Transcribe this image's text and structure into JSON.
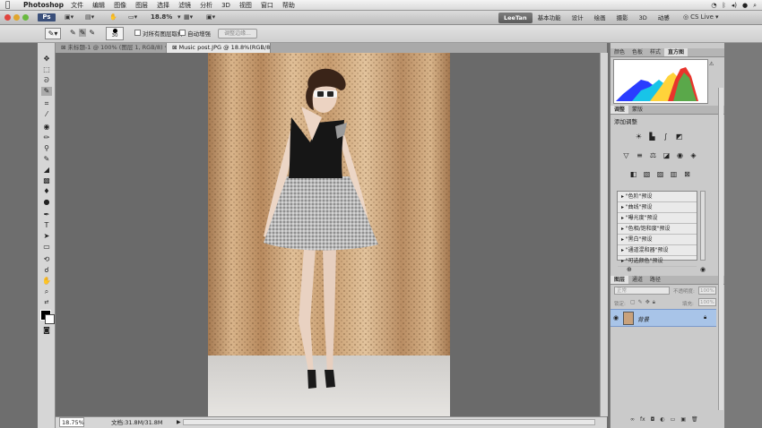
{
  "menubar": {
    "app_name": "Photoshop",
    "items": [
      "文件",
      "编辑",
      "图像",
      "图层",
      "选择",
      "滤镜",
      "分析",
      "3D",
      "视图",
      "窗口",
      "帮助"
    ],
    "right": "CS Live"
  },
  "appbar": {
    "zoom": "18.8%",
    "workspaces": [
      "LeeTan",
      "基本功能",
      "设计",
      "绘画",
      "摄影",
      "3D",
      "动感"
    ]
  },
  "options": {
    "brush_size": "30",
    "checkbox1": "对所有图层取样",
    "checkbox2": "自动增强",
    "refine_button": "调整边缘..."
  },
  "tabs": [
    {
      "label": "未标题-1 @ 100% (图层 1, RGB/8) *"
    },
    {
      "label": "Music post.JPG @ 18.8%(RGB/8*) *"
    }
  ],
  "status": {
    "zoom": "18.75%",
    "doc": "文档:31.8M/31.8M"
  },
  "panels": {
    "histogram_tabs": [
      "颜色",
      "色板",
      "样式",
      "直方图"
    ],
    "adjust_tabs": [
      "调整",
      "蒙版"
    ],
    "adjust_title": "添加调整",
    "presets": [
      "\"色阶\"预设",
      "\"曲线\"预设",
      "\"曝光度\"预设",
      "\"色相/饱和度\"预设",
      "\"黑白\"预设",
      "\"通道混和器\"预设",
      "\"可选颜色\"预设"
    ],
    "layers_tabs": [
      "图层",
      "通道",
      "路径"
    ],
    "blend_mode": "正常",
    "opacity_label": "不透明度:",
    "opacity": "100%",
    "lock_label": "锁定:",
    "fill_label": "填充:",
    "fill": "100%",
    "layer_name": "背景"
  },
  "colors": {
    "accent": "#a8c4e8",
    "workspace_active": "#5a5a5a"
  }
}
